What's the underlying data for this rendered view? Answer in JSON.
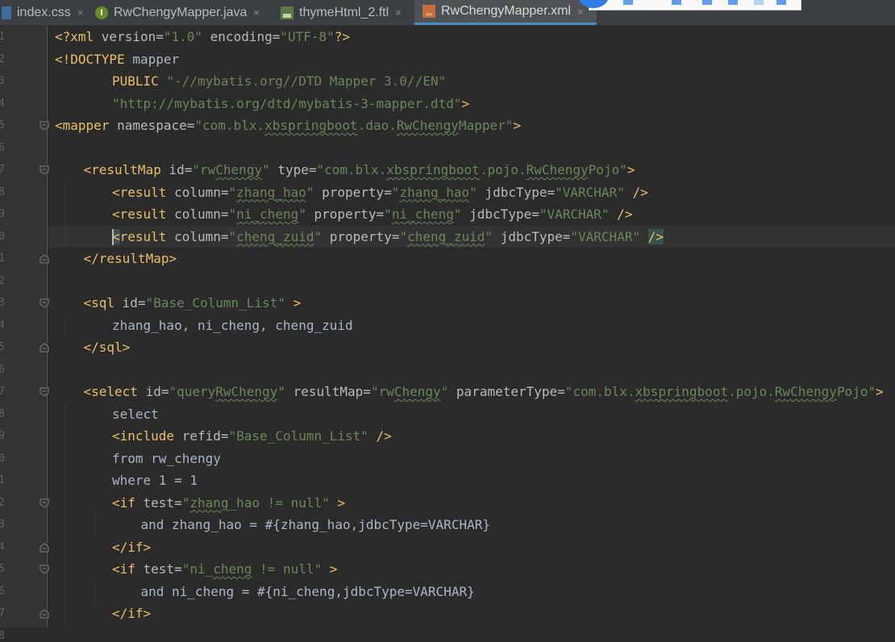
{
  "tabs": [
    {
      "label": "index.css",
      "icon": "css-file-icon",
      "active": false
    },
    {
      "label": "RwChengyMapper.java",
      "icon": "java-interface-icon",
      "active": false
    },
    {
      "label": "thymeHtml_2.ftl",
      "icon": "ftl-file-icon",
      "active": false
    },
    {
      "label": "RwChengyMapper.xml",
      "icon": "xml-file-icon",
      "active": true
    }
  ],
  "tab_close_glyph": "×",
  "line_numbers": [
    "1",
    "2",
    "3",
    "4",
    "5",
    "6",
    "7",
    "8",
    "9",
    "0",
    "1",
    "2",
    "3",
    "4",
    "5",
    "6",
    "7",
    "8",
    "9",
    "0",
    "1",
    "2",
    "3",
    "4",
    "5",
    "6",
    "7",
    "8"
  ],
  "code_lines": [
    {
      "indent": 0,
      "segments": [
        {
          "t": "tag",
          "v": "<?xml "
        },
        {
          "t": "attr",
          "v": "version="
        },
        {
          "t": "str",
          "v": "\"1.0\""
        },
        {
          "t": "attr",
          "v": " encoding="
        },
        {
          "t": "str",
          "v": "\"UTF-8\""
        },
        {
          "t": "tag",
          "v": "?>"
        }
      ]
    },
    {
      "indent": 0,
      "segments": [
        {
          "t": "tag",
          "v": "<!DOCTYPE "
        },
        {
          "t": "txt",
          "v": "mapper"
        }
      ]
    },
    {
      "indent": 2,
      "segments": [
        {
          "t": "tag",
          "v": "PUBLIC "
        },
        {
          "t": "str",
          "v": "\"-//mybatis.org//DTD Mapper 3.0//EN\""
        }
      ]
    },
    {
      "indent": 2,
      "segments": [
        {
          "t": "str",
          "v": "\"http://mybatis.org/dtd/mybatis-3-mapper.dtd\""
        },
        {
          "t": "tag",
          "v": ">"
        }
      ]
    },
    {
      "indent": 0,
      "segments": [
        {
          "t": "tag",
          "v": "<mapper "
        },
        {
          "t": "attr",
          "v": "namespace="
        },
        {
          "t": "str",
          "v": "\"com.blx."
        },
        {
          "t": "strsq",
          "v": "xbspringboot"
        },
        {
          "t": "str",
          "v": ".dao."
        },
        {
          "t": "strsq",
          "v": "RwChengy"
        },
        {
          "t": "str",
          "v": "Mapper\""
        },
        {
          "t": "tag",
          "v": ">"
        }
      ]
    },
    {
      "indent": 0,
      "segments": []
    },
    {
      "indent": 1,
      "segments": [
        {
          "t": "tag",
          "v": "<resultMap "
        },
        {
          "t": "attr",
          "v": "id="
        },
        {
          "t": "str",
          "v": "\"rw"
        },
        {
          "t": "strsq",
          "v": "Chengy"
        },
        {
          "t": "str",
          "v": "\""
        },
        {
          "t": "attr",
          "v": " type="
        },
        {
          "t": "str",
          "v": "\"com.blx."
        },
        {
          "t": "strsq",
          "v": "xbspringboot"
        },
        {
          "t": "str",
          "v": ".pojo."
        },
        {
          "t": "strsq",
          "v": "RwChengy"
        },
        {
          "t": "str",
          "v": "Pojo\""
        },
        {
          "t": "tag",
          "v": ">"
        }
      ]
    },
    {
      "indent": 2,
      "segments": [
        {
          "t": "tag",
          "v": "<result "
        },
        {
          "t": "attr",
          "v": "column="
        },
        {
          "t": "str",
          "v": "\""
        },
        {
          "t": "strsq",
          "v": "zhang_hao"
        },
        {
          "t": "str",
          "v": "\""
        },
        {
          "t": "attr",
          "v": " property="
        },
        {
          "t": "str",
          "v": "\""
        },
        {
          "t": "strsq",
          "v": "zhang_hao"
        },
        {
          "t": "str",
          "v": "\""
        },
        {
          "t": "attr",
          "v": " jdbcType="
        },
        {
          "t": "str",
          "v": "\"VARCHAR\""
        },
        {
          "t": "tag",
          "v": " />"
        }
      ]
    },
    {
      "indent": 2,
      "segments": [
        {
          "t": "tag",
          "v": "<result "
        },
        {
          "t": "attr",
          "v": "column="
        },
        {
          "t": "str",
          "v": "\""
        },
        {
          "t": "strsq",
          "v": "ni_cheng"
        },
        {
          "t": "str",
          "v": "\""
        },
        {
          "t": "attr",
          "v": " property="
        },
        {
          "t": "str",
          "v": "\""
        },
        {
          "t": "strsq",
          "v": "ni_cheng"
        },
        {
          "t": "str",
          "v": "\""
        },
        {
          "t": "attr",
          "v": " jdbcType="
        },
        {
          "t": "str",
          "v": "\"VARCHAR\""
        },
        {
          "t": "tag",
          "v": " />"
        }
      ]
    },
    {
      "indent": 2,
      "segments": [
        {
          "t": "hl",
          "v": "<"
        },
        {
          "t": "tag",
          "v": "result "
        },
        {
          "t": "attr",
          "v": "column="
        },
        {
          "t": "str",
          "v": "\""
        },
        {
          "t": "strsq",
          "v": "cheng_zuid"
        },
        {
          "t": "str",
          "v": "\""
        },
        {
          "t": "attr",
          "v": " property="
        },
        {
          "t": "str",
          "v": "\""
        },
        {
          "t": "strsq",
          "v": "cheng_zuid"
        },
        {
          "t": "str",
          "v": "\""
        },
        {
          "t": "attr",
          "v": " jdbcType="
        },
        {
          "t": "str",
          "v": "\"VARCHAR\""
        },
        {
          "t": "tag",
          "v": " "
        },
        {
          "t": "hl",
          "v": "/>"
        }
      ]
    },
    {
      "indent": 1,
      "segments": [
        {
          "t": "tag",
          "v": "</resultMap>"
        }
      ]
    },
    {
      "indent": 0,
      "segments": []
    },
    {
      "indent": 1,
      "segments": [
        {
          "t": "tag",
          "v": "<sql "
        },
        {
          "t": "attr",
          "v": "id="
        },
        {
          "t": "str",
          "v": "\"Base_Column_List\""
        },
        {
          "t": "tag",
          "v": " >"
        }
      ]
    },
    {
      "indent": 2,
      "segments": [
        {
          "t": "txt",
          "v": "zhang_hao, ni_cheng, cheng_zuid"
        }
      ]
    },
    {
      "indent": 1,
      "segments": [
        {
          "t": "tag",
          "v": "</sql>"
        }
      ]
    },
    {
      "indent": 0,
      "segments": []
    },
    {
      "indent": 1,
      "segments": [
        {
          "t": "tag",
          "v": "<select "
        },
        {
          "t": "attr",
          "v": "id="
        },
        {
          "t": "str",
          "v": "\"query"
        },
        {
          "t": "strsq",
          "v": "RwChengy"
        },
        {
          "t": "str",
          "v": "\""
        },
        {
          "t": "attr",
          "v": " resultMap="
        },
        {
          "t": "str",
          "v": "\"rw"
        },
        {
          "t": "strsq",
          "v": "Chengy"
        },
        {
          "t": "str",
          "v": "\""
        },
        {
          "t": "attr",
          "v": " parameterType="
        },
        {
          "t": "str",
          "v": "\"com.blx."
        },
        {
          "t": "strsq",
          "v": "xbspringboot"
        },
        {
          "t": "str",
          "v": ".pojo."
        },
        {
          "t": "strsq",
          "v": "RwChengy"
        },
        {
          "t": "str",
          "v": "Pojo\""
        },
        {
          "t": "tag",
          "v": ">"
        }
      ]
    },
    {
      "indent": 2,
      "segments": [
        {
          "t": "txt",
          "v": "select"
        }
      ]
    },
    {
      "indent": 2,
      "segments": [
        {
          "t": "tag",
          "v": "<include "
        },
        {
          "t": "attr",
          "v": "refid="
        },
        {
          "t": "str",
          "v": "\"Base_Column_List\""
        },
        {
          "t": "tag",
          "v": " />"
        }
      ]
    },
    {
      "indent": 2,
      "segments": [
        {
          "t": "txt",
          "v": "from rw_chengy"
        }
      ]
    },
    {
      "indent": 2,
      "segments": [
        {
          "t": "txt",
          "v": "where 1 = 1"
        }
      ]
    },
    {
      "indent": 2,
      "segments": [
        {
          "t": "tag",
          "v": "<if "
        },
        {
          "t": "attr",
          "v": "test="
        },
        {
          "t": "str",
          "v": "\""
        },
        {
          "t": "strsq",
          "v": "zhang"
        },
        {
          "t": "str",
          "v": "_hao != null\""
        },
        {
          "t": "tag",
          "v": " >"
        }
      ]
    },
    {
      "indent": 3,
      "segments": [
        {
          "t": "txt",
          "v": "and zhang_hao = #{zhang_hao,jdbcType=VARCHAR}"
        }
      ]
    },
    {
      "indent": 2,
      "segments": [
        {
          "t": "tag",
          "v": "</if>"
        }
      ]
    },
    {
      "indent": 2,
      "segments": [
        {
          "t": "tag",
          "v": "<if "
        },
        {
          "t": "attr",
          "v": "test="
        },
        {
          "t": "str",
          "v": "\"ni_"
        },
        {
          "t": "strsq",
          "v": "cheng"
        },
        {
          "t": "str",
          "v": " != null\""
        },
        {
          "t": "tag",
          "v": " >"
        }
      ]
    },
    {
      "indent": 3,
      "segments": [
        {
          "t": "txt",
          "v": "and ni_cheng = #{ni_cheng,jdbcType=VARCHAR}"
        }
      ]
    },
    {
      "indent": 2,
      "segments": [
        {
          "t": "tag",
          "v": "</if>"
        }
      ]
    }
  ],
  "fold_markers": [
    {
      "line": 4,
      "kind": "open"
    },
    {
      "line": 6,
      "kind": "open"
    },
    {
      "line": 10,
      "kind": "close"
    },
    {
      "line": 12,
      "kind": "open"
    },
    {
      "line": 14,
      "kind": "close"
    },
    {
      "line": 16,
      "kind": "open"
    },
    {
      "line": 21,
      "kind": "open"
    },
    {
      "line": 23,
      "kind": "close"
    },
    {
      "line": 24,
      "kind": "open"
    },
    {
      "line": 26,
      "kind": "close"
    }
  ],
  "current_line": 9,
  "colors": {
    "background": "#2b2b2b",
    "gutter": "#313335",
    "tag": "#e8bf6a",
    "attribute": "#bababa",
    "string": "#6a8759",
    "text": "#a9b7c6",
    "accent": "#4a88c7"
  }
}
